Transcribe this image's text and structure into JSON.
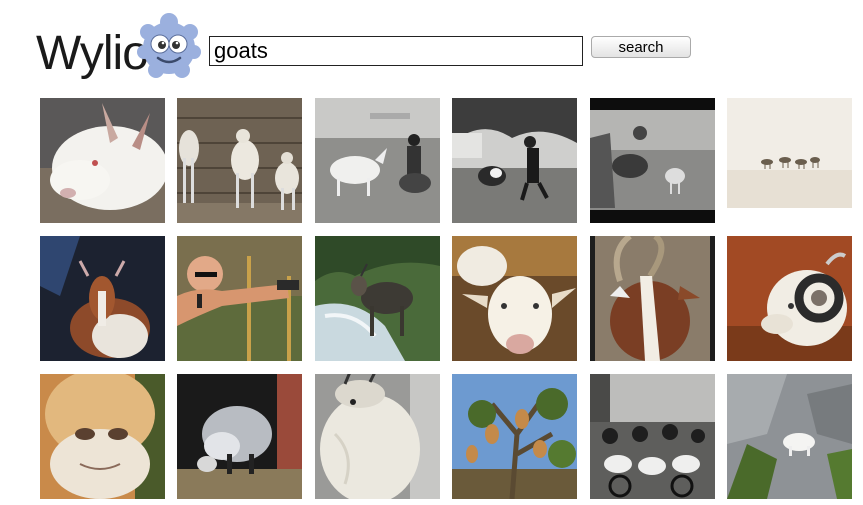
{
  "logo": {
    "text": "Wylio",
    "mascot_icon": "blue-furry-monster-icon"
  },
  "search": {
    "value": "goats",
    "button_label": "search"
  },
  "results": [
    {
      "name": "white-goat-closeup"
    },
    {
      "name": "three-goats-barn"
    },
    {
      "name": "bw-goat-soldier"
    },
    {
      "name": "bw-goat-field-man"
    },
    {
      "name": "bw-goat-photo-frame"
    },
    {
      "name": "camels-desert"
    },
    {
      "name": "goat-dark-background"
    },
    {
      "name": "man-aiming-pistol"
    },
    {
      "name": "goat-mountain-stream"
    },
    {
      "name": "white-goat-smiling"
    },
    {
      "name": "horned-goat-closeup"
    },
    {
      "name": "ram-curled-horns"
    },
    {
      "name": "goat-nose-closeup"
    },
    {
      "name": "pygmy-goat-shed"
    },
    {
      "name": "white-mountain-goat"
    },
    {
      "name": "goats-in-tree"
    },
    {
      "name": "bw-goat-cart"
    },
    {
      "name": "goat-rock-cliff"
    }
  ]
}
